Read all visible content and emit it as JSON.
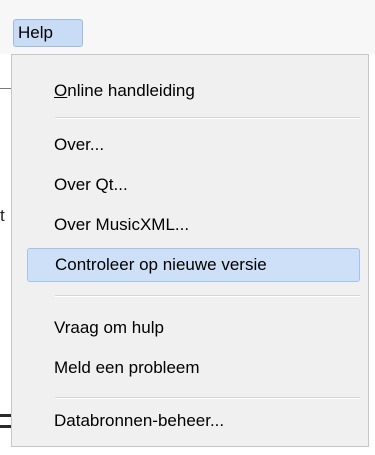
{
  "menubar": {
    "help_label": "Help"
  },
  "background": {
    "left_fragment_text": "t"
  },
  "help_menu": {
    "items": [
      {
        "label": "Online handleiding"
      },
      {
        "label": "Over..."
      },
      {
        "label": "Over Qt..."
      },
      {
        "label": "Over MusicXML..."
      },
      {
        "label": "Controleer op nieuwe versie",
        "highlighted": true
      },
      {
        "label": "Vraag om hulp"
      },
      {
        "label": "Meld een probleem"
      },
      {
        "label": "Databronnen-beheer..."
      }
    ]
  },
  "colors": {
    "highlight": "#cde0f7",
    "highlight_border": "#a3c3ec",
    "menu_background": "#f0f0f0"
  }
}
